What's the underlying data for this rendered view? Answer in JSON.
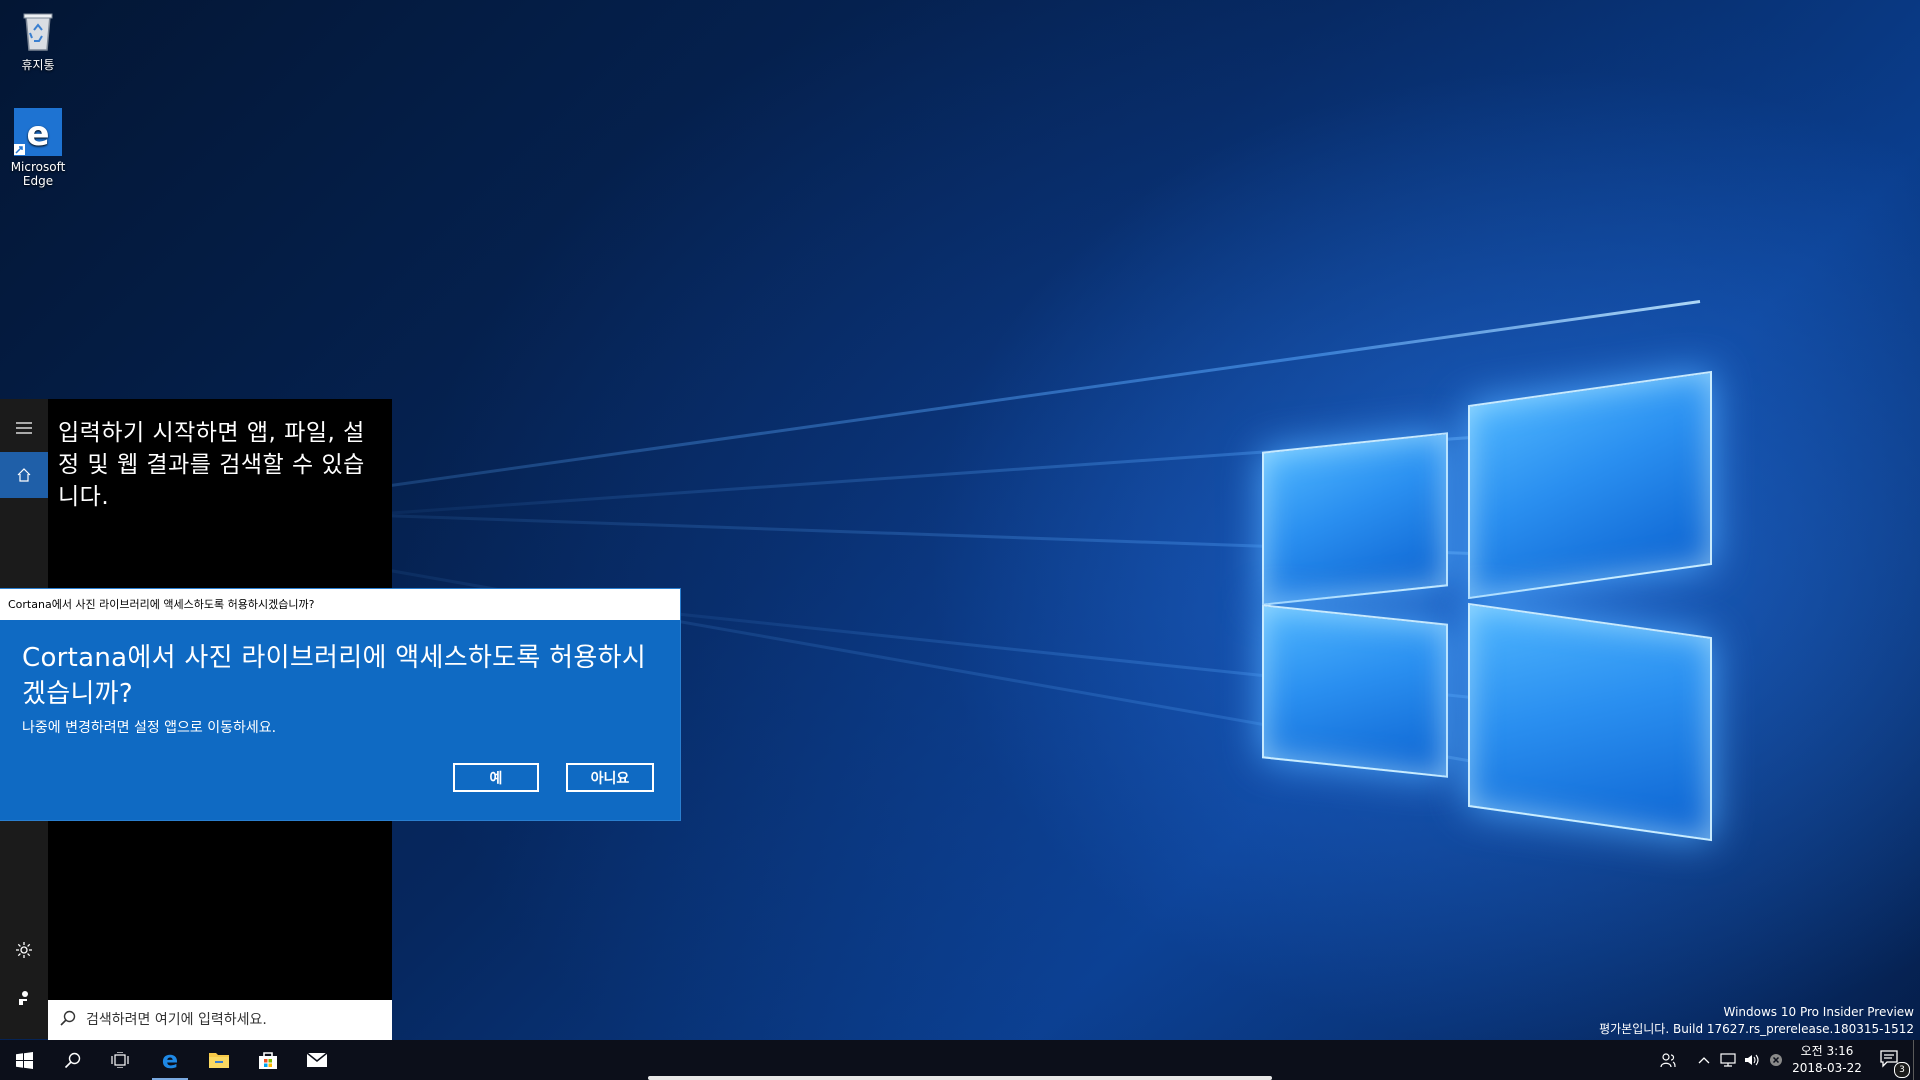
{
  "desktop": {
    "icons": [
      {
        "label": "휴지통",
        "icon": "recycle-bin-icon"
      },
      {
        "label": "Microsoft Edge",
        "icon": "edge-icon"
      }
    ]
  },
  "search_panel": {
    "hint": "입력하기 시작하면 앱, 파일, 설정 및 웹 결과를 검색할 수 있습니다.",
    "rail": [
      {
        "icon": "hamburger-menu-icon"
      },
      {
        "icon": "home-icon"
      },
      {
        "icon": "gear-icon"
      },
      {
        "icon": "feedback-icon"
      }
    ],
    "search_placeholder": "검색하려면 여기에 입력하세요."
  },
  "dialog": {
    "title": "Cortana에서 사진 라이브러리에 액세스하도록 허용하시겠습니까?",
    "heading": "Cortana에서 사진 라이브러리에 액세스하도록 허용하시겠습니까?",
    "subtitle": "나중에 변경하려면 설정 앱으로 이동하세요.",
    "yes_label": "예",
    "no_label": "아니요",
    "accent_color": "#0f6ac3"
  },
  "watermark": {
    "line1": "Windows 10 Pro Insider Preview",
    "line2": "평가본입니다. Build 17627.rs_prerelease.180315-1512"
  },
  "taskbar": {
    "items": [
      {
        "icon": "windows-start-icon"
      },
      {
        "icon": "search-icon"
      },
      {
        "icon": "task-view-icon"
      },
      {
        "icon": "edge-icon"
      },
      {
        "icon": "file-explorer-icon"
      },
      {
        "icon": "store-icon"
      },
      {
        "icon": "mail-icon"
      }
    ],
    "tray": [
      "people-icon",
      "chevron-up-icon",
      "network-icon",
      "volume-icon",
      "no-connection-icon"
    ],
    "time": "오전 3:16",
    "date": "2018-03-22",
    "notification_count": "3"
  }
}
